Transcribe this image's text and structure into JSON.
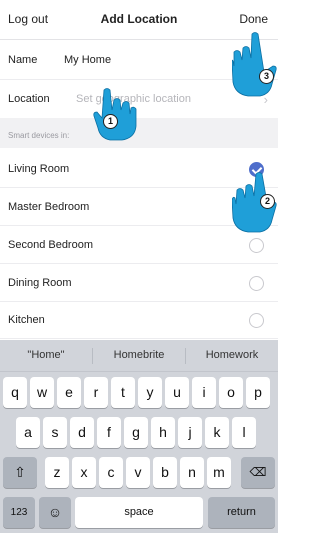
{
  "navbar": {
    "left": "Log out",
    "title": "Add Location",
    "right": "Done"
  },
  "form": {
    "name_label": "Name",
    "name_value": "My Home",
    "location_label": "Location",
    "location_placeholder": "Set geographic location"
  },
  "section_label": "Smart devices in:",
  "devices": [
    {
      "label": "Living Room",
      "checked": true
    },
    {
      "label": "Master Bedroom",
      "checked": false
    },
    {
      "label": "Second Bedroom",
      "checked": false
    },
    {
      "label": "Dining Room",
      "checked": false
    },
    {
      "label": "Kitchen",
      "checked": false
    }
  ],
  "keyboard": {
    "suggestions": [
      "\"Home\"",
      "Homebrite",
      "Homework"
    ],
    "row1": [
      "q",
      "w",
      "e",
      "r",
      "t",
      "y",
      "u",
      "i",
      "o",
      "p"
    ],
    "row2": [
      "a",
      "s",
      "d",
      "f",
      "g",
      "h",
      "j",
      "k",
      "l"
    ],
    "row3": [
      "z",
      "x",
      "c",
      "v",
      "b",
      "n",
      "m"
    ],
    "shift": "⇧",
    "backspace": "⌫",
    "numbers": "123",
    "emoji": "☺",
    "space": "space",
    "return": "return"
  },
  "annotations": [
    "1",
    "2",
    "3"
  ],
  "colors": {
    "accent": "#4f6ecb",
    "hand": "#1f9fd8"
  }
}
